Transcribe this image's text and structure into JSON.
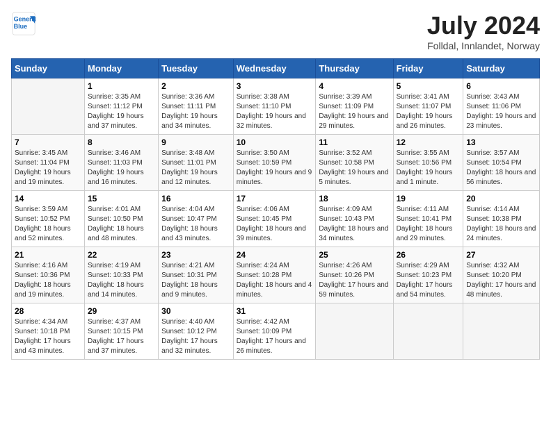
{
  "header": {
    "logo_line1": "General",
    "logo_line2": "Blue",
    "month_year": "July 2024",
    "location": "Folldal, Innlandet, Norway"
  },
  "days_of_week": [
    "Sunday",
    "Monday",
    "Tuesday",
    "Wednesday",
    "Thursday",
    "Friday",
    "Saturday"
  ],
  "weeks": [
    [
      {
        "day": "",
        "info": ""
      },
      {
        "day": "1",
        "info": "Sunrise: 3:35 AM\nSunset: 11:12 PM\nDaylight: 19 hours and 37 minutes."
      },
      {
        "day": "2",
        "info": "Sunrise: 3:36 AM\nSunset: 11:11 PM\nDaylight: 19 hours and 34 minutes."
      },
      {
        "day": "3",
        "info": "Sunrise: 3:38 AM\nSunset: 11:10 PM\nDaylight: 19 hours and 32 minutes."
      },
      {
        "day": "4",
        "info": "Sunrise: 3:39 AM\nSunset: 11:09 PM\nDaylight: 19 hours and 29 minutes."
      },
      {
        "day": "5",
        "info": "Sunrise: 3:41 AM\nSunset: 11:07 PM\nDaylight: 19 hours and 26 minutes."
      },
      {
        "day": "6",
        "info": "Sunrise: 3:43 AM\nSunset: 11:06 PM\nDaylight: 19 hours and 23 minutes."
      }
    ],
    [
      {
        "day": "7",
        "info": "Sunrise: 3:45 AM\nSunset: 11:04 PM\nDaylight: 19 hours and 19 minutes."
      },
      {
        "day": "8",
        "info": "Sunrise: 3:46 AM\nSunset: 11:03 PM\nDaylight: 19 hours and 16 minutes."
      },
      {
        "day": "9",
        "info": "Sunrise: 3:48 AM\nSunset: 11:01 PM\nDaylight: 19 hours and 12 minutes."
      },
      {
        "day": "10",
        "info": "Sunrise: 3:50 AM\nSunset: 10:59 PM\nDaylight: 19 hours and 9 minutes."
      },
      {
        "day": "11",
        "info": "Sunrise: 3:52 AM\nSunset: 10:58 PM\nDaylight: 19 hours and 5 minutes."
      },
      {
        "day": "12",
        "info": "Sunrise: 3:55 AM\nSunset: 10:56 PM\nDaylight: 19 hours and 1 minute."
      },
      {
        "day": "13",
        "info": "Sunrise: 3:57 AM\nSunset: 10:54 PM\nDaylight: 18 hours and 56 minutes."
      }
    ],
    [
      {
        "day": "14",
        "info": "Sunrise: 3:59 AM\nSunset: 10:52 PM\nDaylight: 18 hours and 52 minutes."
      },
      {
        "day": "15",
        "info": "Sunrise: 4:01 AM\nSunset: 10:50 PM\nDaylight: 18 hours and 48 minutes."
      },
      {
        "day": "16",
        "info": "Sunrise: 4:04 AM\nSunset: 10:47 PM\nDaylight: 18 hours and 43 minutes."
      },
      {
        "day": "17",
        "info": "Sunrise: 4:06 AM\nSunset: 10:45 PM\nDaylight: 18 hours and 39 minutes."
      },
      {
        "day": "18",
        "info": "Sunrise: 4:09 AM\nSunset: 10:43 PM\nDaylight: 18 hours and 34 minutes."
      },
      {
        "day": "19",
        "info": "Sunrise: 4:11 AM\nSunset: 10:41 PM\nDaylight: 18 hours and 29 minutes."
      },
      {
        "day": "20",
        "info": "Sunrise: 4:14 AM\nSunset: 10:38 PM\nDaylight: 18 hours and 24 minutes."
      }
    ],
    [
      {
        "day": "21",
        "info": "Sunrise: 4:16 AM\nSunset: 10:36 PM\nDaylight: 18 hours and 19 minutes."
      },
      {
        "day": "22",
        "info": "Sunrise: 4:19 AM\nSunset: 10:33 PM\nDaylight: 18 hours and 14 minutes."
      },
      {
        "day": "23",
        "info": "Sunrise: 4:21 AM\nSunset: 10:31 PM\nDaylight: 18 hours and 9 minutes."
      },
      {
        "day": "24",
        "info": "Sunrise: 4:24 AM\nSunset: 10:28 PM\nDaylight: 18 hours and 4 minutes."
      },
      {
        "day": "25",
        "info": "Sunrise: 4:26 AM\nSunset: 10:26 PM\nDaylight: 17 hours and 59 minutes."
      },
      {
        "day": "26",
        "info": "Sunrise: 4:29 AM\nSunset: 10:23 PM\nDaylight: 17 hours and 54 minutes."
      },
      {
        "day": "27",
        "info": "Sunrise: 4:32 AM\nSunset: 10:20 PM\nDaylight: 17 hours and 48 minutes."
      }
    ],
    [
      {
        "day": "28",
        "info": "Sunrise: 4:34 AM\nSunset: 10:18 PM\nDaylight: 17 hours and 43 minutes."
      },
      {
        "day": "29",
        "info": "Sunrise: 4:37 AM\nSunset: 10:15 PM\nDaylight: 17 hours and 37 minutes."
      },
      {
        "day": "30",
        "info": "Sunrise: 4:40 AM\nSunset: 10:12 PM\nDaylight: 17 hours and 32 minutes."
      },
      {
        "day": "31",
        "info": "Sunrise: 4:42 AM\nSunset: 10:09 PM\nDaylight: 17 hours and 26 minutes."
      },
      {
        "day": "",
        "info": ""
      },
      {
        "day": "",
        "info": ""
      },
      {
        "day": "",
        "info": ""
      }
    ]
  ]
}
